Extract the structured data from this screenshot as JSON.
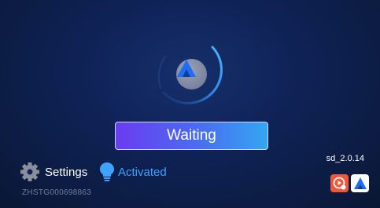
{
  "status": {
    "button_label": "Waiting",
    "version": "sd_2.0.14"
  },
  "settings": {
    "label": "Settings",
    "icon": "gear-icon"
  },
  "activation": {
    "label": "Activated",
    "icon": "lightbulb-icon"
  },
  "device": {
    "serial": "ZHSTG000698863"
  },
  "apps": [
    {
      "name": "carlife-app-icon"
    },
    {
      "name": "android-auto-app-icon"
    }
  ],
  "colors": {
    "background": "#0f2358",
    "accent_blue": "#3fa2ff",
    "button_gradient_start": "#6a3cf0",
    "button_gradient_end": "#34a6f2"
  }
}
